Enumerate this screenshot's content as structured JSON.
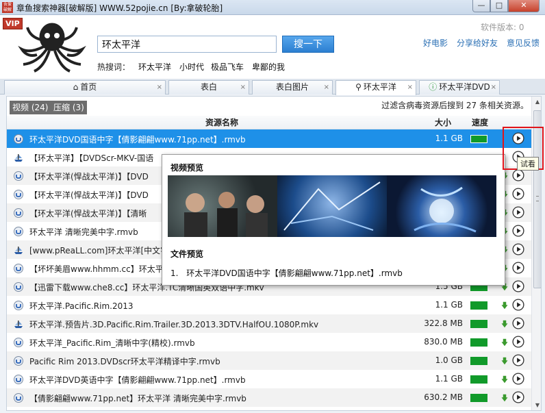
{
  "window": {
    "logo_text": "吾爱破解",
    "title": "章鱼搜索神器[破解版] WWW.52pojie.cn [By:拿破轮胎]",
    "min_glyph": "—",
    "max_glyph": "□",
    "close_glyph": "✕"
  },
  "header": {
    "vip": "VIP",
    "search_value": "环太平洋",
    "search_button": "搜一下",
    "hot_label": "热搜词：",
    "hot_words": [
      "环太平洋",
      "小时代",
      "极品飞车",
      "卑鄙的我"
    ],
    "version": "软件版本: 0",
    "links": [
      "好电影",
      "分享给好友",
      "意见反馈"
    ]
  },
  "tabs": [
    {
      "label": "首页",
      "icon": "home-icon",
      "close": "×"
    },
    {
      "label": "表白",
      "close": "×"
    },
    {
      "label": "表白图片",
      "close": "×"
    },
    {
      "label": "环太平洋",
      "icon": "search-icon",
      "close": "×"
    },
    {
      "label": "环太平洋DVD",
      "icon": "info-icon",
      "close": "×"
    }
  ],
  "filters": [
    {
      "label": "视频 (24)"
    },
    {
      "label": "压缩 (3)"
    }
  ],
  "summary": "过滤含病毒资源后搜到  27 条相关资源。",
  "columns": {
    "name": "资源名称",
    "size": "大小",
    "speed": "速度"
  },
  "rows": [
    {
      "icon": "magnet-icon",
      "name": "环太平洋DVD国语中字【倩影翩翩www.71pp.net】.rmvb",
      "size": "1.1 GB",
      "selected": true
    },
    {
      "icon": "ship-icon",
      "name": "【环太平洋】【DVDScr-MKV-国语",
      "size": ""
    },
    {
      "icon": "magnet-icon",
      "name": "【环太平洋(悍战太平洋)】【DVD",
      "size": ""
    },
    {
      "icon": "magnet-icon",
      "name": "【环太平洋(悍战太平洋)】【DVD",
      "size": ""
    },
    {
      "icon": "magnet-icon",
      "name": "【环太平洋(悍战太平洋)】【清晰",
      "size": ""
    },
    {
      "icon": "magnet-icon",
      "name": "环太平洋 清晰完美中字.rmvb",
      "size": ""
    },
    {
      "icon": "ship-icon",
      "name": "[www.pReaLL.com]环太平洋[中文字",
      "size": ""
    },
    {
      "icon": "magnet-icon",
      "name": "【坏坏美眉www.hhmm.cc】环太平",
      "size": ""
    },
    {
      "icon": "magnet-icon",
      "name": "【迅雷下载www.che8.cc】环太平洋.TC清晰国英双语中字.mkv",
      "size": "1.5 GB"
    },
    {
      "icon": "magnet-icon",
      "name": "环太平洋.Pacific.Rim.2013",
      "size": "1.1 GB"
    },
    {
      "icon": "ship-icon",
      "name": "环太平洋.预告片.3D.Pacific.Rim.Trailer.3D.2013.3DTV.HalfOU.1080P.mkv",
      "size": "322.8 MB"
    },
    {
      "icon": "magnet-icon",
      "name": "环太平洋_Pacific.Rim_清晰中字(精校).rmvb",
      "size": "830.0 MB"
    },
    {
      "icon": "magnet-icon",
      "name": "Pacific Rim 2013.DVDscr环太平洋精译中字.rmvb",
      "size": "1.0 GB"
    },
    {
      "icon": "magnet-icon",
      "name": "环太平洋DVD英语中字【倩影翩翩www.71pp.net】.rmvb",
      "size": "1.1 GB"
    },
    {
      "icon": "magnet-icon",
      "name": "【倩影翩翩www.71pp.net】环太平洋 清晰完美中字.rmvb",
      "size": "630.2 MB"
    }
  ],
  "preview": {
    "video_title": "视频预览",
    "file_title": "文件预览",
    "file_number": "1.",
    "file_name": "环太平洋DVD国语中字【倩影翩翩www.71pp.net】.rmvb"
  },
  "tooltip": "试看",
  "colors": {
    "selected": "#1e90e8",
    "speed": "#119a2a",
    "callout": "#e0141a",
    "link": "#2a6fb4"
  }
}
